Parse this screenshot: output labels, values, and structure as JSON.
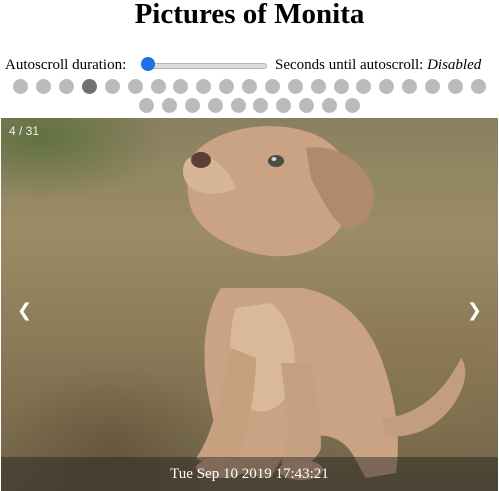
{
  "title": "Pictures of Monita",
  "controls": {
    "autoscroll_label": "Autoscroll duration:",
    "autoscroll_value": 0,
    "seconds_label": "Seconds until autoscroll:",
    "seconds_value": "Disabled"
  },
  "dots": {
    "count": 31,
    "active_index": 4
  },
  "slide": {
    "counter": "4 / 31",
    "prev_glyph": "❮",
    "next_glyph": "❯",
    "caption": "Tue Sep 10 2019 17:43:21",
    "image_subject": "puppy-photo"
  }
}
